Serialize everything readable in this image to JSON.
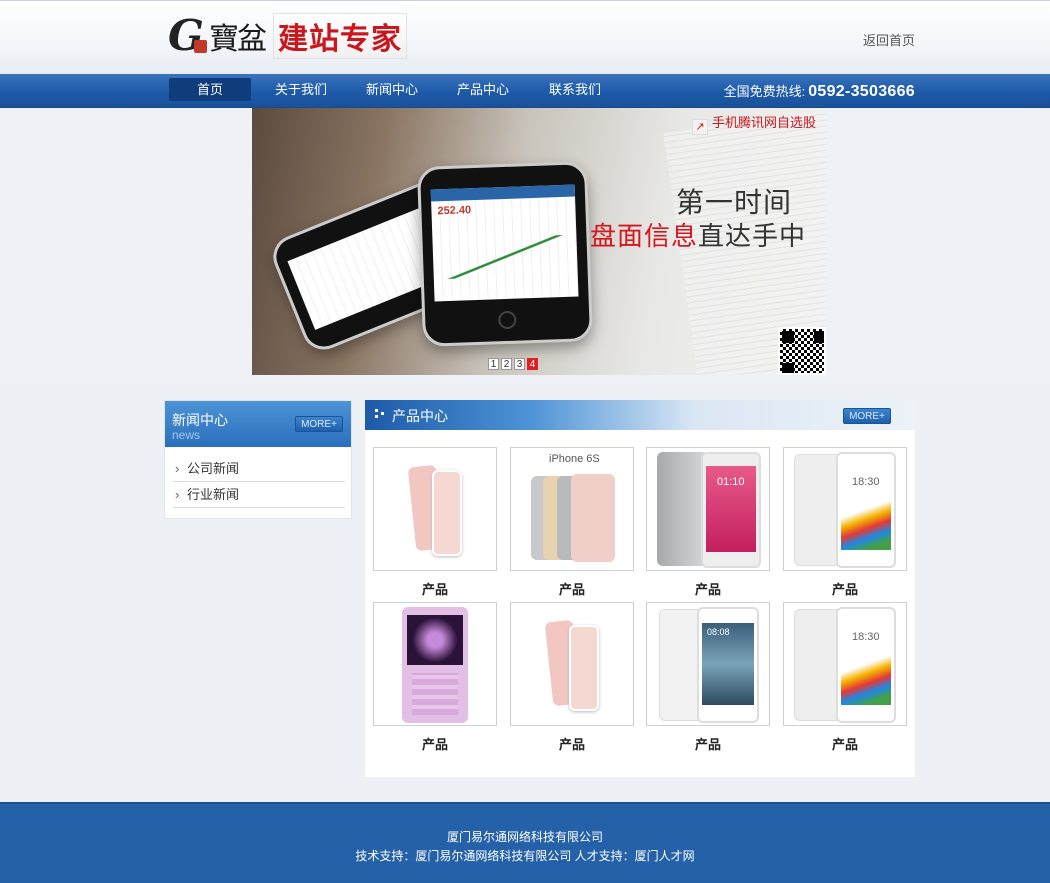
{
  "header": {
    "logo_g": "G",
    "logo_text1": "寶盆",
    "logo_text2": "建站专家",
    "home_link": "返回首页"
  },
  "nav": {
    "items": [
      {
        "label": "首页",
        "active": true
      },
      {
        "label": "关于我们",
        "active": false
      },
      {
        "label": "新闻中心",
        "active": false
      },
      {
        "label": "产品中心",
        "active": false
      },
      {
        "label": "联系我们",
        "active": false
      }
    ],
    "hotline_label": "全国免费热线:",
    "hotline_number": "0592-3503666"
  },
  "banner": {
    "brand": "手机腾讯网自选股",
    "slogan_line1": "第一时间",
    "slogan_line2_red": "盘面信息",
    "slogan_line2_rest": "直达手中",
    "screen_price": "252.40",
    "slides": [
      "1",
      "2",
      "3",
      "4"
    ],
    "active_slide": 4
  },
  "news": {
    "title": "新闻中心",
    "subtitle": "news",
    "more": "MORE+",
    "items": [
      "公司新闻",
      "行业新闻"
    ]
  },
  "products": {
    "title": "产品中心",
    "more": "MORE+",
    "items": [
      {
        "caption": "产品",
        "image": "pink-phone"
      },
      {
        "caption": "产品",
        "image": "iphone6s",
        "image_text": "iPhone 6S"
      },
      {
        "caption": "产品",
        "image": "silver-phone",
        "image_text": "01:10"
      },
      {
        "caption": "产品",
        "image": "meizu-white",
        "image_text": "18:30"
      },
      {
        "caption": "产品",
        "image": "purple-feature-phone"
      },
      {
        "caption": "产品",
        "image": "pink-phone"
      },
      {
        "caption": "产品",
        "image": "huawei-white",
        "image_text": "08:08"
      },
      {
        "caption": "产品",
        "image": "meizu-white",
        "image_text": "18:30"
      }
    ]
  },
  "footer": {
    "company": "厦门易尔通网络科技有限公司",
    "support": "技术支持：厦门易尔通网络科技有限公司  人才支持：厦门人才网"
  }
}
